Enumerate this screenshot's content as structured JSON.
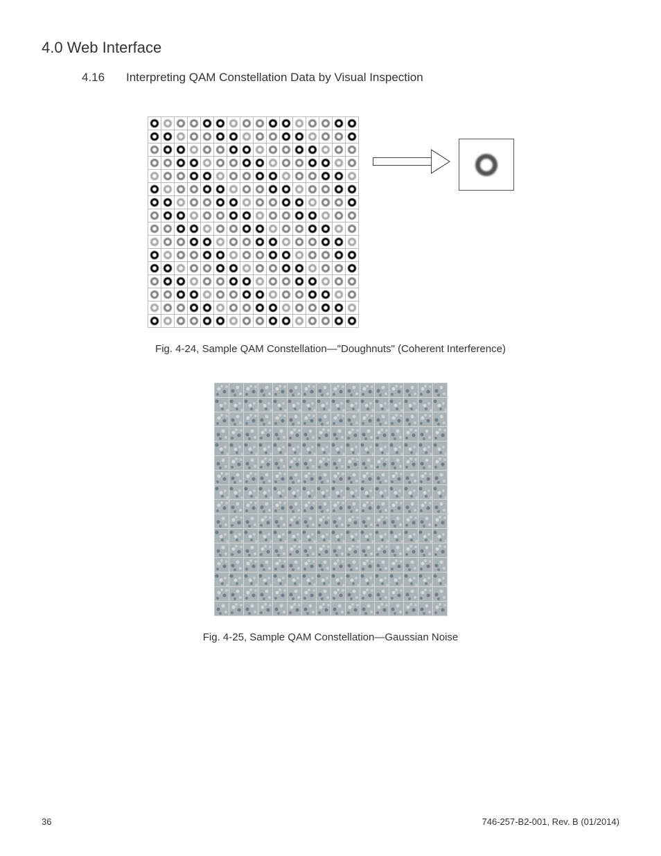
{
  "heading": {
    "chapter": "4.0 Web Interface",
    "section_num": "4.16",
    "section_title": "Interpreting QAM Constellation Data by Visual Inspection"
  },
  "figures": {
    "fig1": {
      "caption": "Fig. 4-24, Sample QAM Constellation—\"Doughnuts\" (Coherent Interference)",
      "grid_size": 16
    },
    "fig2": {
      "caption": "Fig. 4-25, Sample QAM Constellation—Gaussian Noise",
      "grid_size": 16
    }
  },
  "footer": {
    "page_number": "36",
    "doc_id": "746-257-B2-001, Rev. B (01/2014)"
  }
}
